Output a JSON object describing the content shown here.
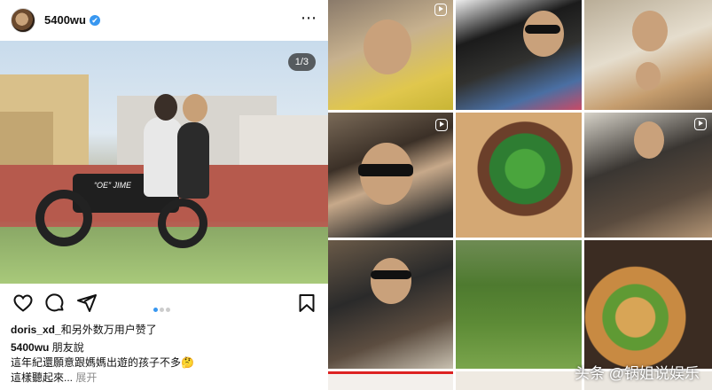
{
  "post": {
    "username": "5400wu",
    "verified_mark": "✔",
    "more_icon": "⋯",
    "image_counter": "1/3",
    "photo_text": "“OE” JIME",
    "likes_user": "doris_xd_",
    "likes_rest": "和另外数万用户赞了",
    "caption_user": "5400wu",
    "caption_line1": "朋友說",
    "caption_line2": "這年紀還願意跟媽媽出遊的孩子不多🤔",
    "caption_line3": "這樣聽起來...",
    "caption_more": "展开"
  },
  "icons": {
    "like": "heart-icon",
    "comment": "comment-icon",
    "share": "send-icon",
    "save": "bookmark-icon",
    "reel": "reel-icon"
  },
  "colors": {
    "accent": "#3897f0",
    "text": "#111111",
    "muted": "#8e8e8e"
  },
  "watermark": "头条 @锅姐说娱乐"
}
